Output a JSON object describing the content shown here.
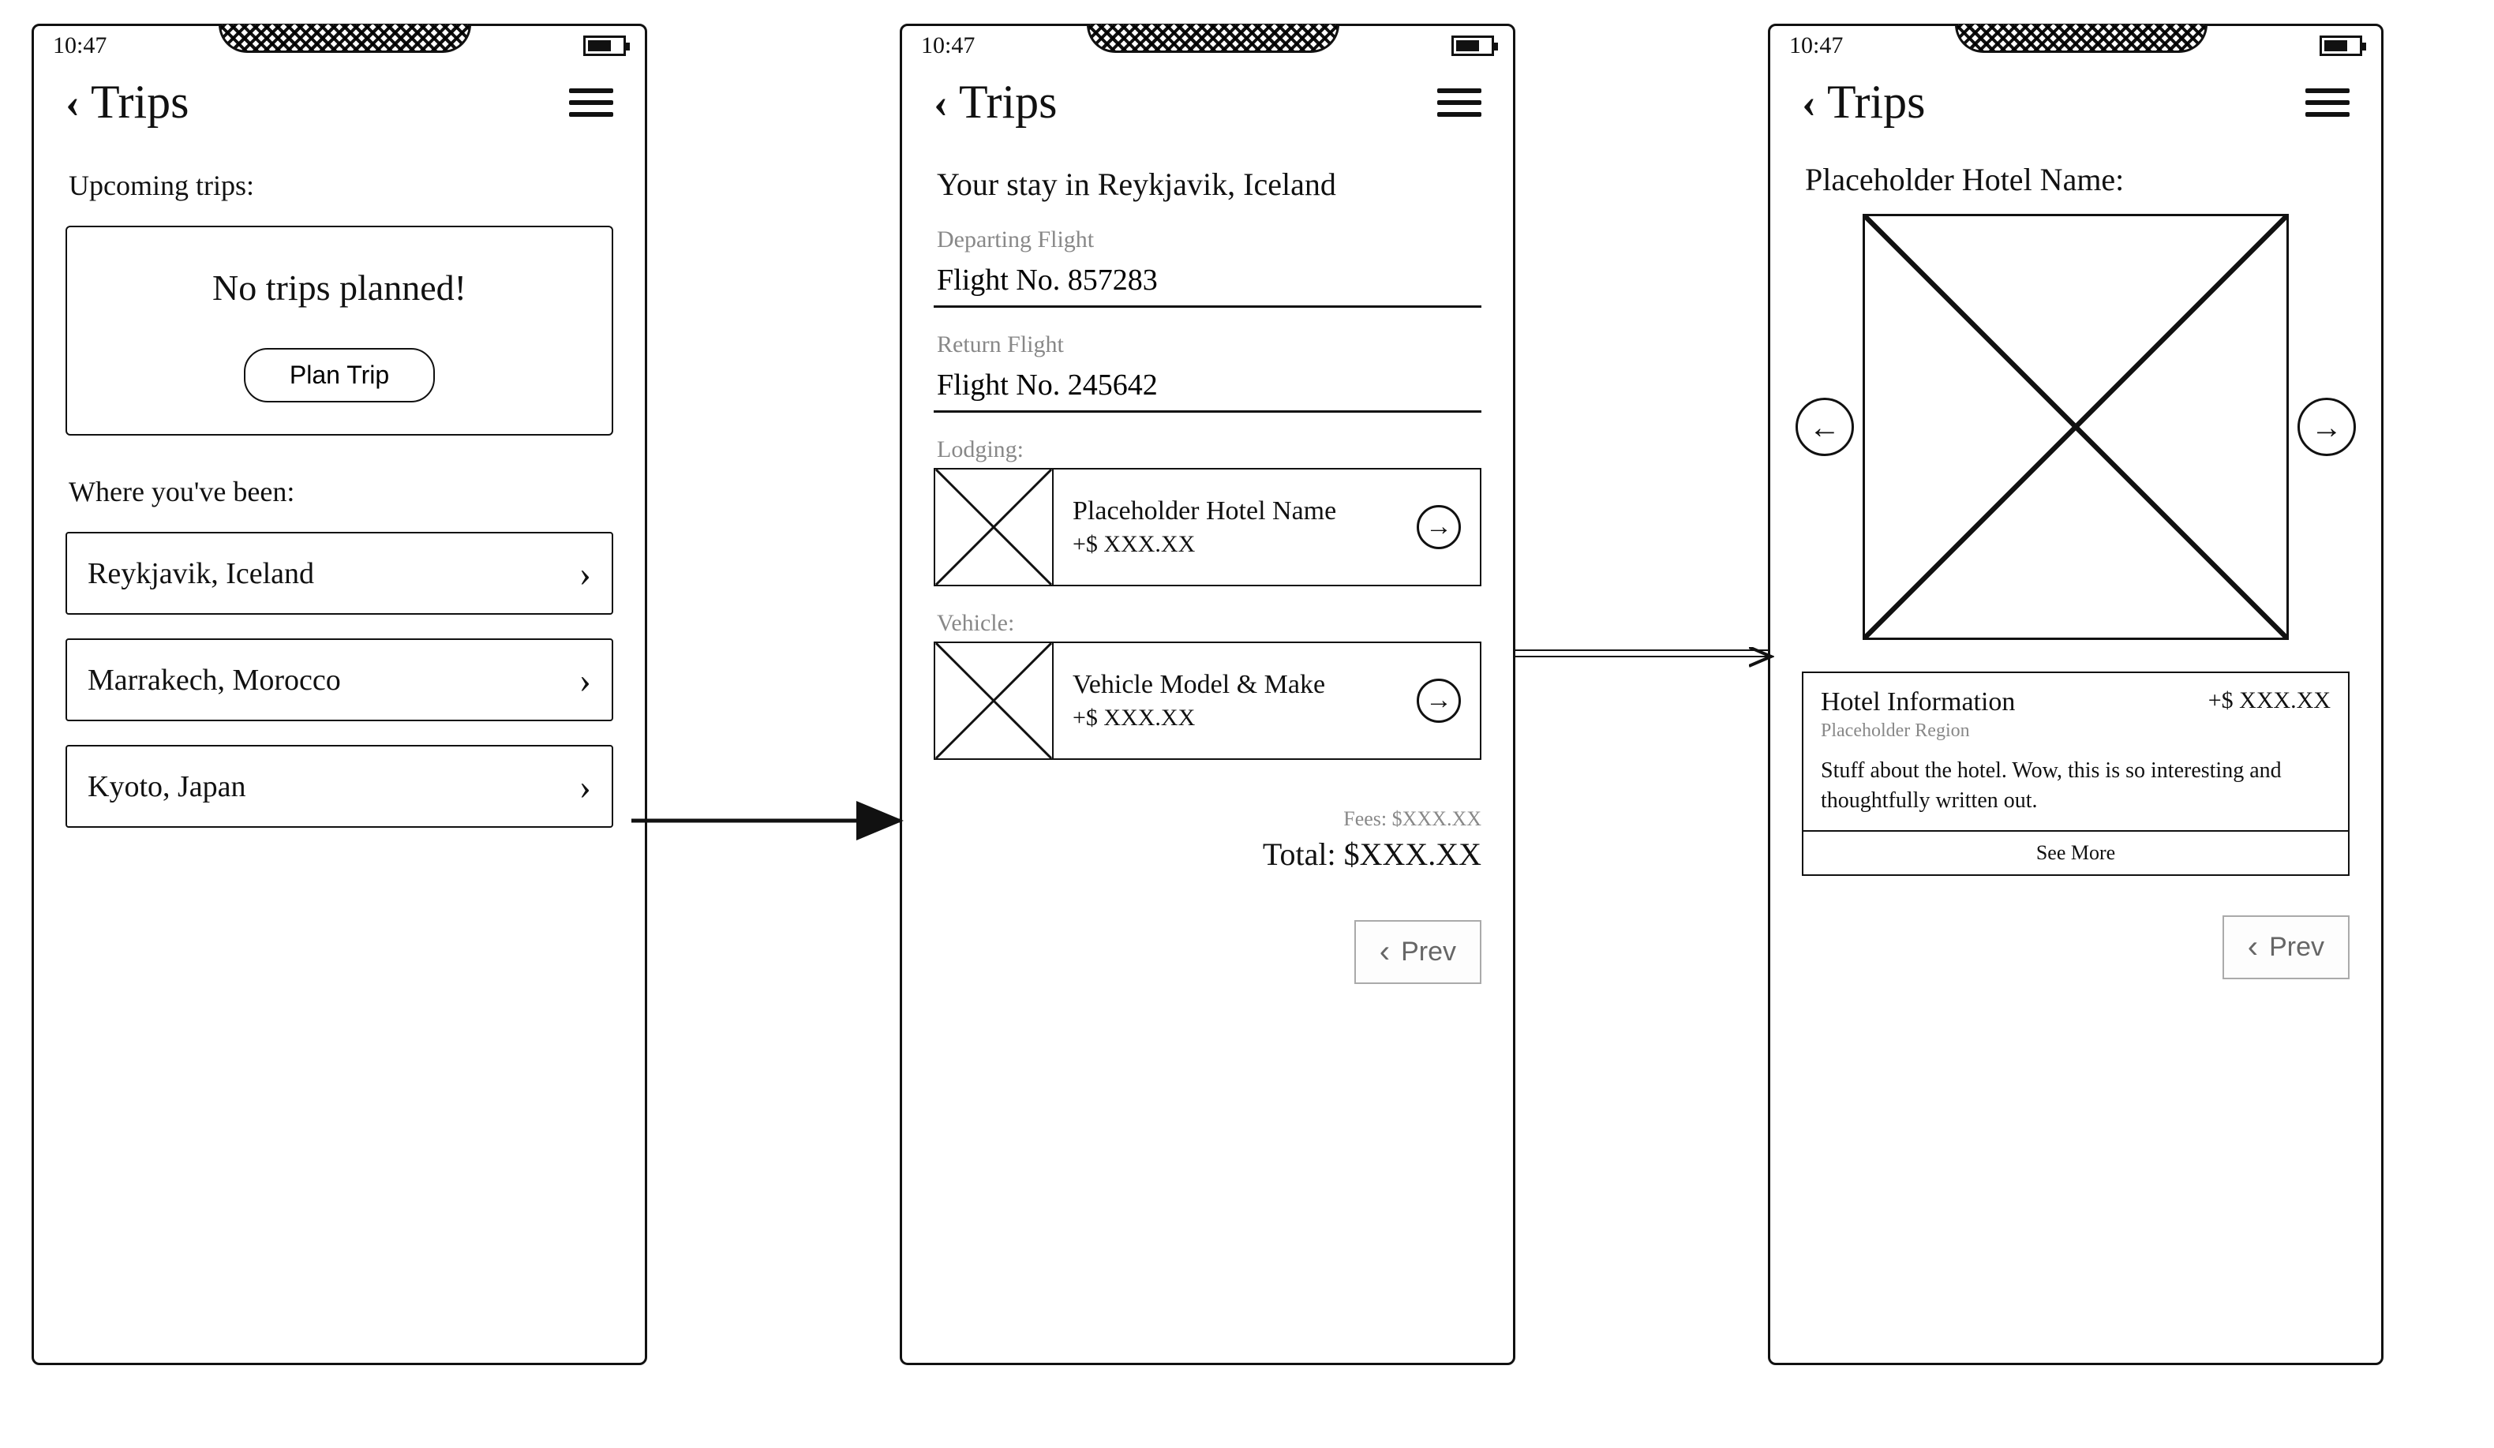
{
  "statusbar": {
    "time": "10:47"
  },
  "header": {
    "title": "Trips"
  },
  "screen1": {
    "upcoming_heading": "Upcoming trips:",
    "empty_message": "No trips planned!",
    "plan_trip_label": "Plan Trip",
    "history_heading": "Where you've been:",
    "history": [
      {
        "label": "Reykjavik, Iceland"
      },
      {
        "label": "Marrakech, Morocco"
      },
      {
        "label": "Kyoto, Japan"
      }
    ]
  },
  "screen2": {
    "stay_title": "Your stay in Reykjavik, Iceland",
    "depart_label": "Departing Flight",
    "depart_value": "Flight No. 857283",
    "return_label": "Return Flight",
    "return_value": "Flight No. 245642",
    "lodging_label": "Lodging:",
    "lodging_name": "Placeholder Hotel Name",
    "lodging_price": "+$ XXX.XX",
    "vehicle_label": "Vehicle:",
    "vehicle_name": "Vehicle Model & Make",
    "vehicle_price": "+$ XXX.XX",
    "fees_text": "Fees: $XXX.XX",
    "total_text": "Total: $XXX.XX",
    "prev_label": "Prev"
  },
  "screen3": {
    "hotel_title": "Placeholder Hotel Name:",
    "info_heading": "Hotel Information",
    "info_price": "+$ XXX.XX",
    "region": "Placeholder Region",
    "description": "Stuff about the hotel. Wow, this is so interesting and thoughtfully written out.",
    "see_more": "See More",
    "prev_label": "Prev"
  }
}
